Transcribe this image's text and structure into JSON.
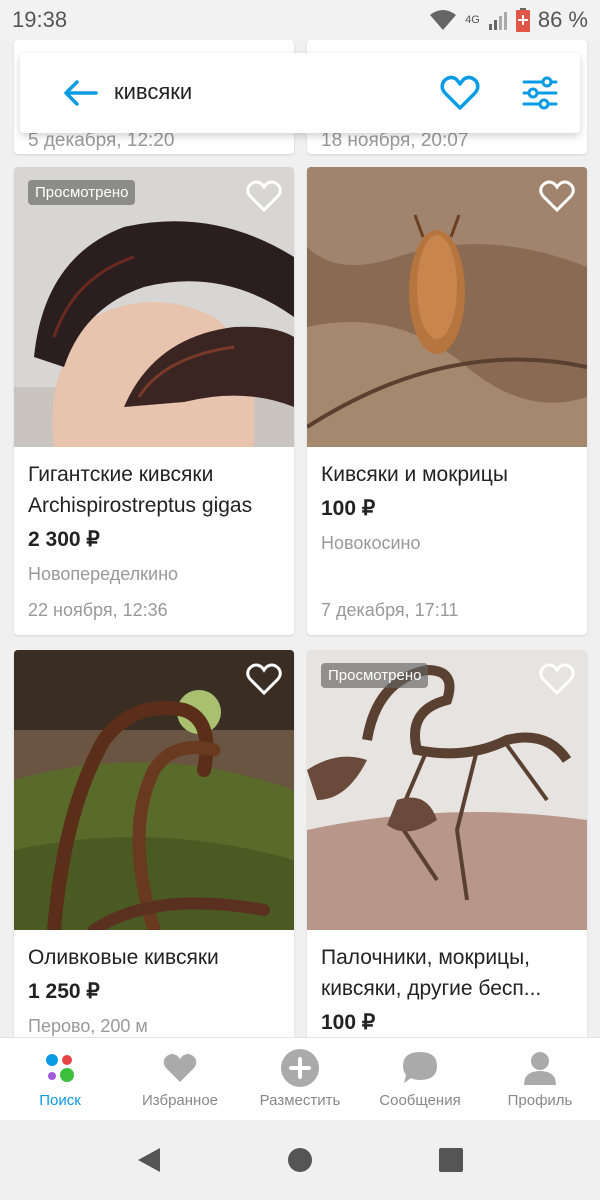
{
  "status_bar": {
    "time": "19:38",
    "network": "4G",
    "battery": "86 %"
  },
  "search": {
    "query": "кивсяки"
  },
  "previous_row": {
    "left_date": "5 декабря, 12:20",
    "right_date": "18 ноября, 20:07"
  },
  "listings": [
    {
      "title": "Гигантские кивсяки Archispirostreptus gigas",
      "price": "2 300 ₽",
      "location": "Новопеределкино",
      "date": "22 ноября, 12:36",
      "badge": "Просмотрено"
    },
    {
      "title": "Кивсяки и мокрицы",
      "price": "100 ₽",
      "location": "Новокосино",
      "date": "7 декабря, 17:11"
    },
    {
      "title": "Оливковые кивсяки",
      "price": "1 250 ₽",
      "location": "Перово, 200 м"
    },
    {
      "title": "Палочники, мокрицы, кивсяки, другие бесп...",
      "price": "100 ₽",
      "badge": "Просмотрено"
    }
  ],
  "bottom_nav": {
    "items": [
      {
        "label": "Поиск",
        "icon": "search-dots-icon",
        "active": true
      },
      {
        "label": "Избранное",
        "icon": "heart-icon"
      },
      {
        "label": "Разместить",
        "icon": "plus-icon"
      },
      {
        "label": "Сообщения",
        "icon": "chat-icon"
      },
      {
        "label": "Профиль",
        "icon": "profile-icon"
      }
    ]
  },
  "colors": {
    "accent": "#0a9be5",
    "price_text": "#222222",
    "muted_text": "#999999"
  }
}
